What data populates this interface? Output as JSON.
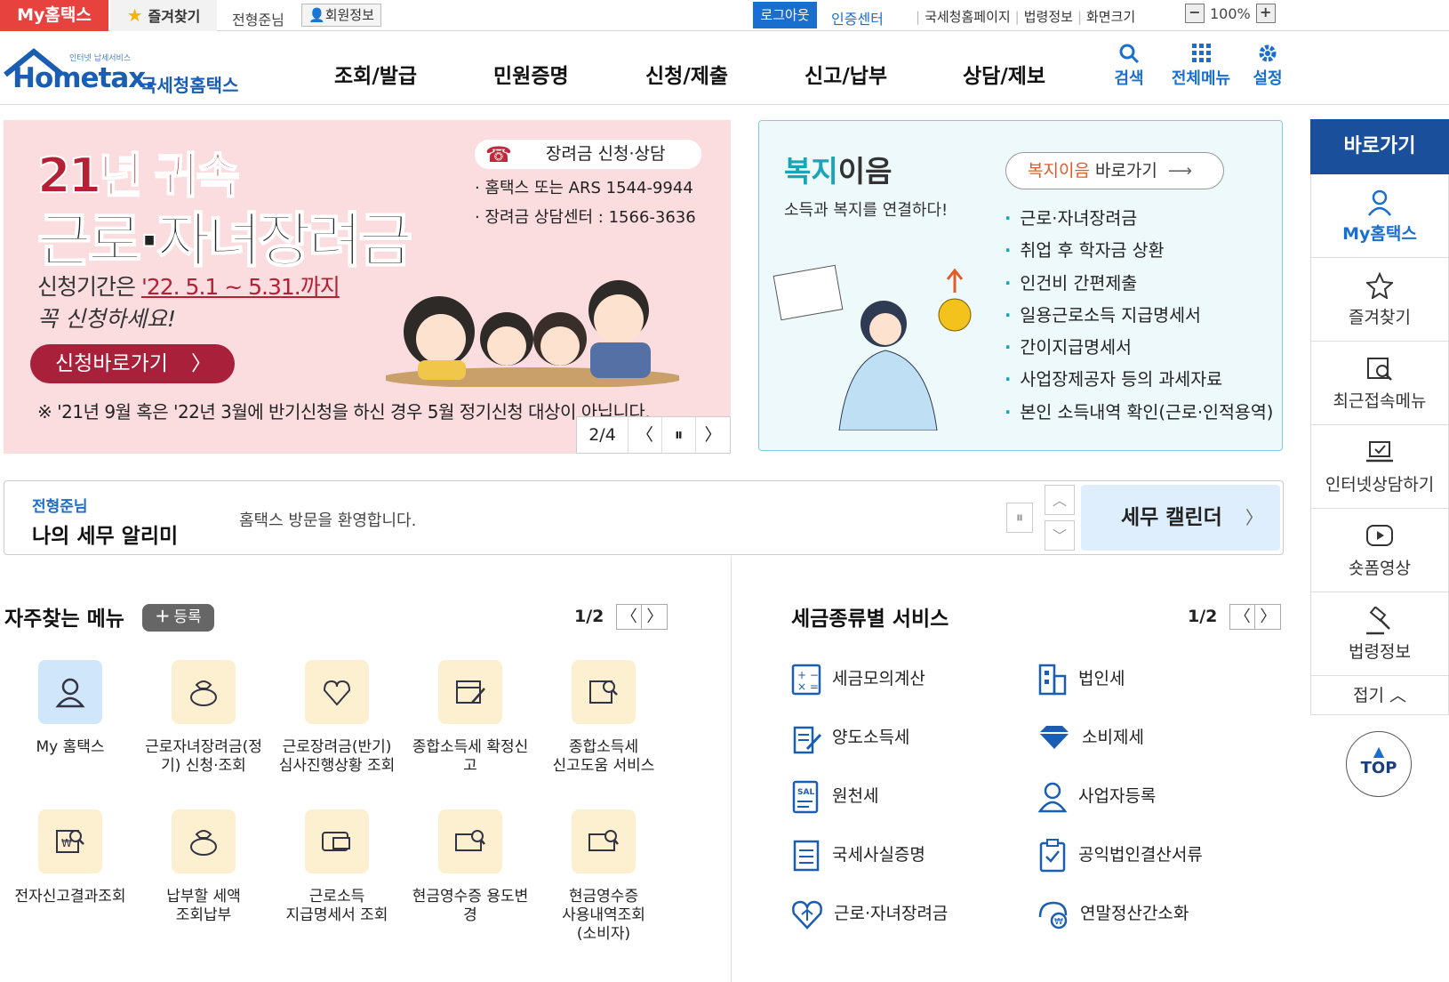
{
  "utilbar": {
    "my_hometax": "My홈택스",
    "favorites": "즐겨찾기",
    "user_name": "전형준님",
    "member_info": "회원정보",
    "logout": "로그아웃",
    "cert_center": "인증센터",
    "link_nts": "국세청홈페이지",
    "link_law": "법령정보",
    "link_screen": "화면크기",
    "zoom": "100%"
  },
  "header": {
    "logo_small": "인터넷 납세서비스",
    "logo_main": "Hometax.",
    "logo_kr": "국세청홈택스",
    "nav": [
      "조회/발급",
      "민원증명",
      "신청/제출",
      "신고/납부",
      "상담/제보"
    ],
    "search": "검색",
    "all_menu": "전체메뉴",
    "settings": "설정"
  },
  "banner": {
    "year": "21년 귀속",
    "title": "근로·자녀장려금",
    "contact_title": "장려금 신청·상담",
    "contact_line1": "· 홈택스 또는 ARS 1544-9944",
    "contact_line2": "· 장려금 상담센터 : 1566-3636",
    "period_prefix": "신청기간은",
    "period": "'22. 5.1 ~ 5.31.까지",
    "must": "꼭 신청하세요!",
    "button": "신청바로가기",
    "note": "※ '21년 9월 혹은 '22년 3월에 반기신청을 하신 경우 5월 정기신청 대상이 아닙니다.",
    "page": "2/4"
  },
  "welfare": {
    "title_a": "복지",
    "title_b": "이음",
    "subtitle": "소득과 복지를 연결하다!",
    "link_a": "복지이음",
    "link_b": "바로가기",
    "items": [
      "근로·자녀장려금",
      "취업 후 학자금 상환",
      "인건비 간편제출",
      "일용근로소득 지급명세서",
      "간이지급명세서",
      "사업장제공자 등의 과세자료",
      "본인 소득내역 확인(근로·인적용역)"
    ]
  },
  "quick": {
    "head": "바로가기",
    "items": [
      "My홈택스",
      "즐겨찾기",
      "최근접속메뉴",
      "인터넷상담하기",
      "숏폼영상",
      "법령정보"
    ],
    "fold": "접기",
    "top": "TOP"
  },
  "alert": {
    "name": "전형준님",
    "title": "나의 세무 알리미",
    "message": "홈택스 방문을 환영합니다.",
    "tax_calendar": "세무 캘린더"
  },
  "freq": {
    "title": "자주찾는 메뉴",
    "register": "등록",
    "page": "1/2",
    "items": [
      [
        "My 홈택스"
      ],
      [
        "근로자녀장려금(정",
        "기) 신청·조회"
      ],
      [
        "근로장려금(반기)",
        "심사진행상황 조회"
      ],
      [
        "종합소득세 확정신",
        "고"
      ],
      [
        "종합소득세",
        "신고도움 서비스"
      ],
      [
        "전자신고결과조회"
      ],
      [
        "납부할 세액",
        "조회납부"
      ],
      [
        "근로소득",
        "지급명세서 조회"
      ],
      [
        "현금영수증 용도변",
        "경"
      ],
      [
        "현금영수증",
        "사용내역조회",
        "(소비자)"
      ]
    ]
  },
  "taxsvc": {
    "title": "세금종류별 서비스",
    "page": "1/2",
    "items": [
      "세금모의계산",
      "법인세",
      "양도소득세",
      "소비제세",
      "원천세",
      "사업자등록",
      "국세사실증명",
      "공익법인결산서류",
      "근로·자녀장려금",
      "연말정산간소화"
    ]
  }
}
